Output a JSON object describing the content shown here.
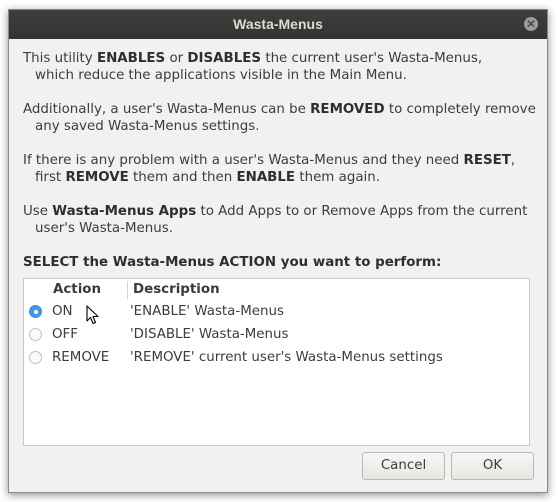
{
  "window": {
    "title": "Wasta-Menus"
  },
  "intro": {
    "p1": [
      "This utility ",
      "ENABLES",
      " or ",
      "DISABLES",
      " the current user's Wasta-Menus,",
      "which reduce the applications visible in the Main Menu."
    ],
    "p2": [
      "Additionally, a user's Wasta-Menus can be ",
      "REMOVED",
      " to completely remove",
      "any saved Wasta-Menus settings."
    ],
    "p3": [
      "If there is any problem with a user's Wasta-Menus and they need ",
      "RESET",
      ",",
      "first ",
      "REMOVE",
      " them and then ",
      "ENABLE",
      " them again."
    ],
    "p4": [
      "Use ",
      "Wasta-Menus Apps",
      " to Add Apps to or Remove Apps from the current",
      "user's Wasta-Menus."
    ]
  },
  "prompt": "SELECT the Wasta-Menus ACTION you want to perform:",
  "table": {
    "headers": {
      "action": "Action",
      "description": "Description"
    },
    "rows": [
      {
        "action": "ON",
        "description": "'ENABLE' Wasta-Menus",
        "selected": true
      },
      {
        "action": "OFF",
        "description": "'DISABLE' Wasta-Menus",
        "selected": false
      },
      {
        "action": "REMOVE",
        "description": "'REMOVE' current user's Wasta-Menus settings",
        "selected": false
      }
    ]
  },
  "buttons": {
    "cancel": "Cancel",
    "ok": "OK"
  },
  "icons": {
    "close": "close-icon",
    "radio": "radio-icon",
    "cursor": "mouse-cursor-icon"
  },
  "colors": {
    "titlebar": "#3e3e3c",
    "accent": "#4a96e0",
    "dialog_bg": "#f2f1f0"
  }
}
